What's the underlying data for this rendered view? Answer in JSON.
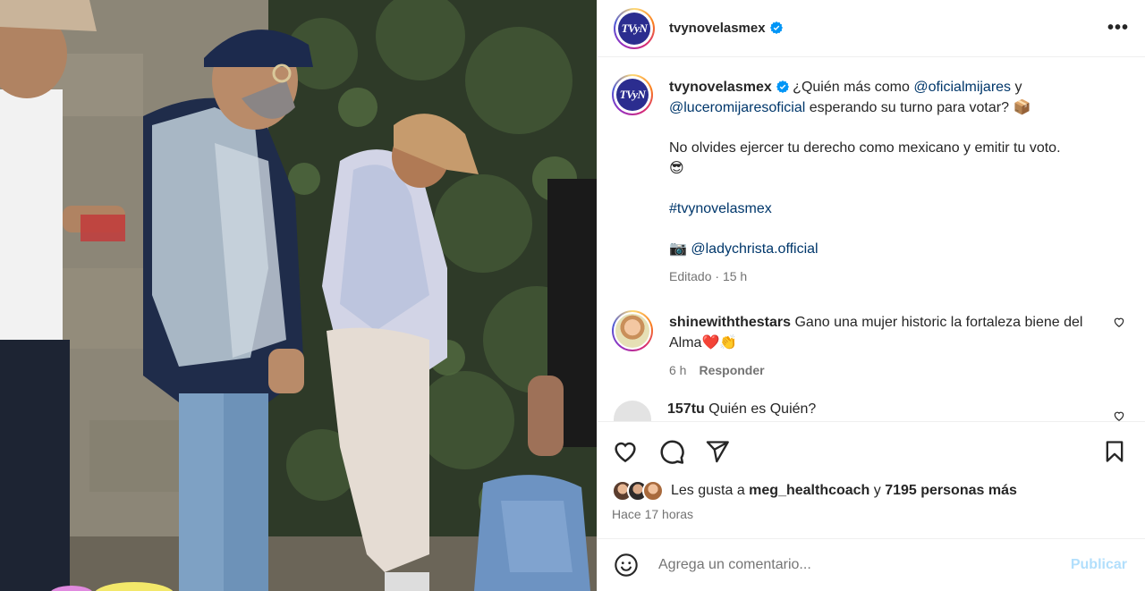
{
  "post": {
    "username": "tvynovelasmex",
    "avatar_text": "TVyN",
    "verified_icon": "verified-badge-icon",
    "more_icon": "more-options-icon"
  },
  "caption": {
    "username": "tvynovelasmex",
    "line1_pre": " ¿Quién más como ",
    "mention1": "@oficialmijares",
    "line1_post": " y",
    "mention2": "@luceromijaresoficial",
    "line2_post": " esperando su turno para votar? ",
    "emoji_box": "📦",
    "para2": "No olvides ejercer tu derecho como mexicano y emitir tu voto.",
    "emoji_cool": "😎",
    "hashtag": "#tvynovelasmex",
    "camera_emoji": "📷",
    "credit": "@ladychrista.official",
    "edited": "Editado",
    "edited_time": "15 h"
  },
  "comments": [
    {
      "username": "shinewiththestars",
      "text": " Gano una mujer historic la fortaleza biene del Alma",
      "emoji": "❤️👏",
      "time": "6 h",
      "reply": "Responder"
    },
    {
      "username": "157tu",
      "text": " Quién es Quién?"
    }
  ],
  "actions": {
    "like_icon": "heart-icon",
    "comment_icon": "comment-icon",
    "share_icon": "share-icon",
    "save_icon": "bookmark-icon"
  },
  "likes": {
    "prefix": "Les gusta a ",
    "user": "meg_healthcoach",
    "mid": " y ",
    "count": "7195 personas más"
  },
  "posted": "Hace 17 horas",
  "add_comment": {
    "emoji_icon": "emoji-smile-icon",
    "placeholder": "Agrega un comentario...",
    "publish": "Publicar"
  },
  "colors": {
    "link": "#00376b",
    "verified": "#0095f6",
    "publish_disabled": "#b2dffc",
    "secondary_text": "#737373"
  }
}
